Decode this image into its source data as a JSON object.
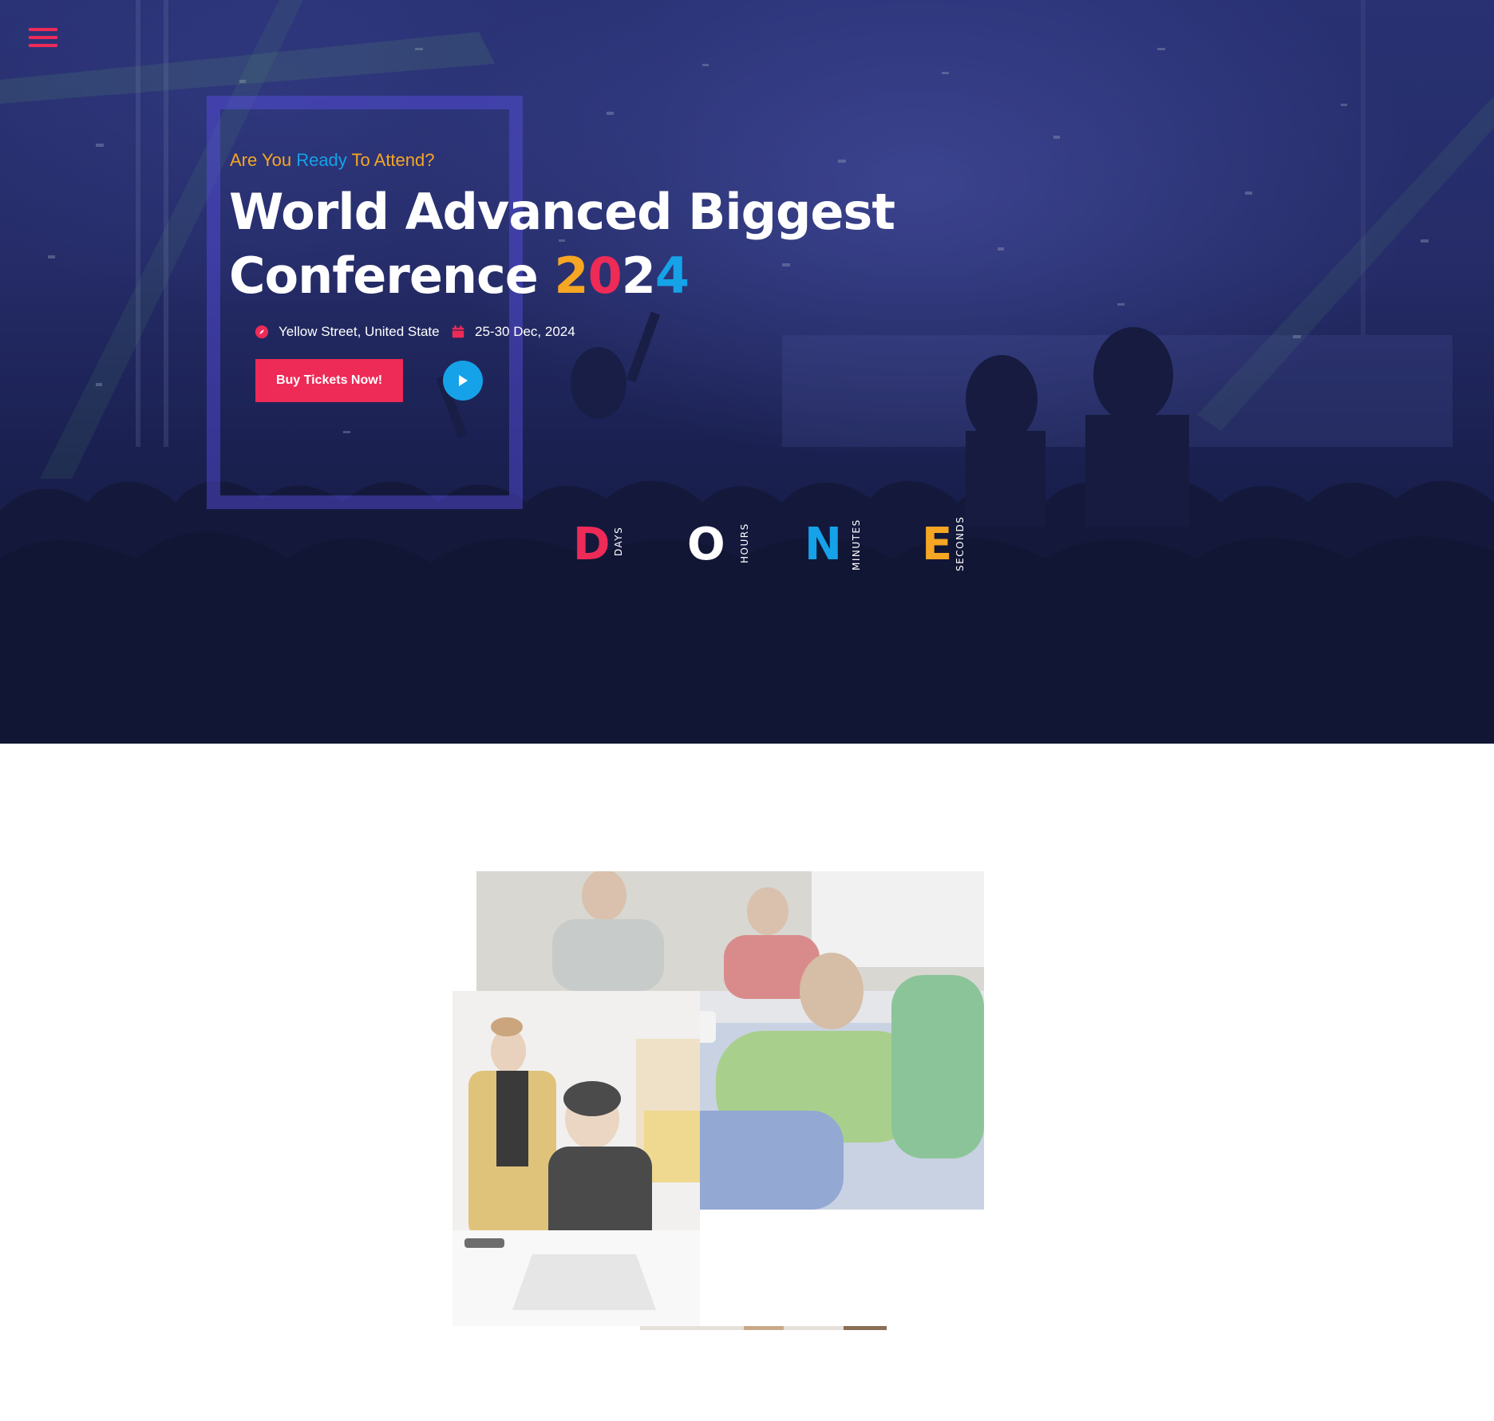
{
  "hero": {
    "tagline": {
      "part1": "Are You",
      "part2": "Ready",
      "part3": "To Attend?"
    },
    "title": {
      "line1_plain": "World Advanced ",
      "line1_highlight": "Biggest",
      "line2_plain": "Conference ",
      "year_digits": [
        "2",
        "0",
        "2",
        "4"
      ]
    },
    "location": "Yellow Street, United State",
    "date": "25-30 Dec, 2024",
    "buy_button_label": "Buy Tickets Now!",
    "countdown": [
      {
        "value": "D",
        "label": "DAYS",
        "color": "#ee2a57"
      },
      {
        "value": "O",
        "label": "HOURS",
        "color": "#ffffff"
      },
      {
        "value": "N",
        "label": "MINUTES",
        "color": "#15a2e8"
      },
      {
        "value": "E",
        "label": "SECONDS",
        "color": "#f5a623"
      }
    ]
  },
  "icons": {
    "menu": "hamburger-menu-icon",
    "location": "compass-icon",
    "date": "calendar-icon",
    "play": "play-icon"
  },
  "colors": {
    "accent_pink": "#ee2a57",
    "accent_blue": "#15a2e8",
    "accent_orange": "#f5a623",
    "hero_dark": "#1c2356"
  }
}
